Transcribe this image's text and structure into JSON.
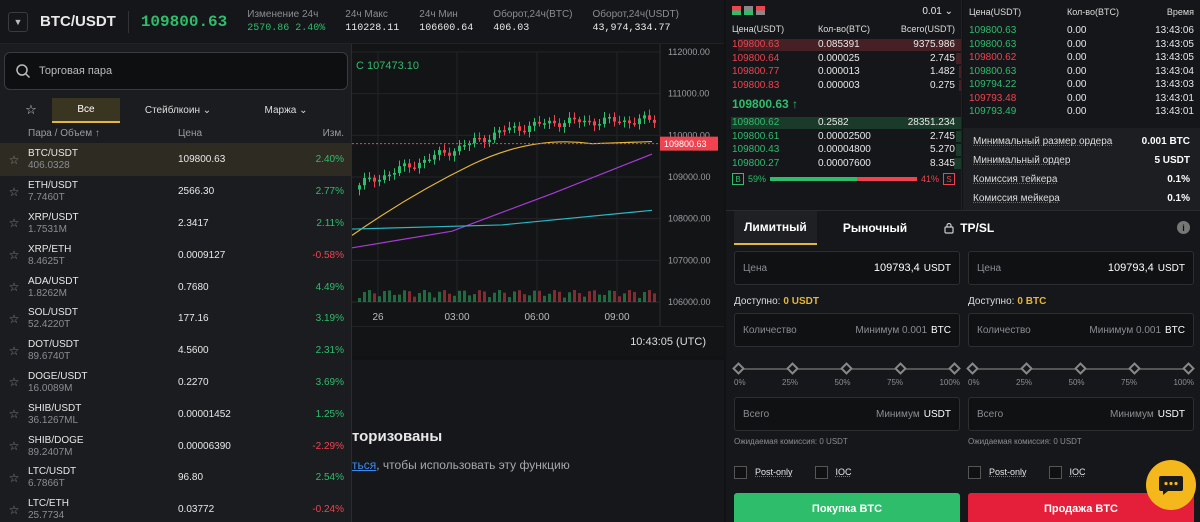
{
  "header": {
    "pair": "BTC/USDT",
    "price": "109800.63",
    "stats": [
      {
        "label": "Изменение 24ч",
        "value": "2570.86 2.40%",
        "color": "green"
      },
      {
        "label": "24ч Макс",
        "value": "110228.11",
        "color": "white"
      },
      {
        "label": "24ч Мин",
        "value": "106600.64",
        "color": "white"
      },
      {
        "label": "Оборот,24ч(BTC)",
        "value": "406.03",
        "color": "white"
      },
      {
        "label": "Оборот,24ч(USDT)",
        "value": "43,974,334.77",
        "color": "white"
      }
    ]
  },
  "market": {
    "search_placeholder": "Торговая пара",
    "tabs": [
      "Все",
      "Стейблкоин ⌄",
      "Маржа ⌄"
    ],
    "col_pair": "Пара / Объем ↑",
    "col_price": "Цена",
    "col_change": "Изм.",
    "rows": [
      {
        "pair": "BTC/USDT",
        "vol": "406.0328",
        "price": "109800.63",
        "change": "2.40%",
        "up": true,
        "selected": true
      },
      {
        "pair": "ETH/USDT",
        "vol": "7.7460T",
        "price": "2566.30",
        "change": "2.77%",
        "up": true
      },
      {
        "pair": "XRP/USDT",
        "vol": "1.7531M",
        "price": "2.3417",
        "change": "2.11%",
        "up": true
      },
      {
        "pair": "XRP/ETH",
        "vol": "8.4625T",
        "price": "0.0009127",
        "change": "-0.58%",
        "up": false
      },
      {
        "pair": "ADA/USDT",
        "vol": "1.8262M",
        "price": "0.7680",
        "change": "4.49%",
        "up": true
      },
      {
        "pair": "SOL/USDT",
        "vol": "52.4220T",
        "price": "177.16",
        "change": "3.19%",
        "up": true
      },
      {
        "pair": "DOT/USDT",
        "vol": "89.6740T",
        "price": "4.5600",
        "change": "2.31%",
        "up": true
      },
      {
        "pair": "DOGE/USDT",
        "vol": "16.0089M",
        "price": "0.2270",
        "change": "3.69%",
        "up": true
      },
      {
        "pair": "SHIB/USDT",
        "vol": "36.1267ML",
        "price": "0.00001452",
        "change": "1.25%",
        "up": true
      },
      {
        "pair": "SHIB/DOGE",
        "vol": "89.2407M",
        "price": "0.00006390",
        "change": "-2.29%",
        "up": false
      },
      {
        "pair": "LTC/USDT",
        "vol": "6.7866T",
        "price": "96.80",
        "change": "2.54%",
        "up": true
      },
      {
        "pair": "LTC/ETH",
        "vol": "25.7734",
        "price": "0.03772",
        "change": "-0.24%",
        "up": false
      }
    ]
  },
  "chart": {
    "close_label": "C 107473.10",
    "price_badge": "109800.63",
    "y_ticks": [
      "112000.00",
      "111000.00",
      "110000.00",
      "109000.00",
      "108000.00",
      "107000.00",
      "106000.00"
    ],
    "x_ticks": [
      "26",
      "03:00",
      "06:00",
      "09:00"
    ],
    "time": "10:43:05 (UTC)",
    "colors": {
      "up": "#2ebd6b",
      "down": "#f0434f",
      "ma1": "#e4b63c",
      "ma2": "#a63bd6",
      "ma3": "#2bb7c4"
    }
  },
  "auth_notice": {
    "title": "торизованы",
    "link": "ться",
    "rest": ", чтобы использовать эту функцию"
  },
  "orderbook": {
    "tick": "0.01 ⌄",
    "headers": [
      "Цена(USDT)",
      "Кол-во(BTC)",
      "Всего(USDT)"
    ],
    "asks": [
      {
        "price": "109800.63",
        "qty": "0.085391",
        "total": "9375.986",
        "depth": 0.95,
        "hl": true
      },
      {
        "price": "109800.64",
        "qty": "0.000025",
        "total": "2.745",
        "depth": 0.02
      },
      {
        "price": "109800.77",
        "qty": "0.000013",
        "total": "1.482",
        "depth": 0.01
      },
      {
        "price": "109800.83",
        "qty": "0.000003",
        "total": "0.275",
        "depth": 0.01
      }
    ],
    "mid_price": "109800.63 ↑",
    "bids": [
      {
        "price": "109800.62",
        "qty": "0.2582",
        "total": "28351.234",
        "depth": 0.98,
        "hl": true
      },
      {
        "price": "109800.61",
        "qty": "0.00002500",
        "total": "2.745",
        "depth": 0.02
      },
      {
        "price": "109800.43",
        "qty": "0.00004800",
        "total": "5.270",
        "depth": 0.02
      },
      {
        "price": "109800.27",
        "qty": "0.00007600",
        "total": "8.345",
        "depth": 0.03
      }
    ],
    "buy_label": "B",
    "buy_pct": "59%",
    "sell_pct": "41%",
    "sell_label": "S",
    "buy_ratio": 0.59
  },
  "trades": {
    "headers": [
      "Цена(USDT)",
      "Кол-во(BTC)",
      "Время"
    ],
    "rows": [
      {
        "price": "109800.63",
        "qty": "0.00",
        "time": "13:43:06",
        "up": true
      },
      {
        "price": "109800.63",
        "qty": "0.00",
        "time": "13:43:05",
        "up": true
      },
      {
        "price": "109800.62",
        "qty": "0.00",
        "time": "13:43:05",
        "up": false
      },
      {
        "price": "109800.63",
        "qty": "0.00",
        "time": "13:43:04",
        "up": true
      },
      {
        "price": "109794.22",
        "qty": "0.00",
        "time": "13:43:03",
        "up": true
      },
      {
        "price": "109793.48",
        "qty": "0.00",
        "time": "13:43:01",
        "up": false
      },
      {
        "price": "109793.49",
        "qty": "0.00",
        "time": "13:43:01",
        "up": true
      }
    ]
  },
  "limits": [
    {
      "label": "Минимальный размер ордера",
      "value": "0.001 BTC"
    },
    {
      "label": "Минимальный ордер",
      "value": "5 USDT"
    },
    {
      "label": "Комиссия тейкера",
      "value": "0.1%"
    },
    {
      "label": "Комиссия мейкера",
      "value": "0.1%"
    }
  ],
  "form": {
    "tabs": [
      "Лимитный",
      "Рыночный",
      "TP/SL"
    ],
    "buy": {
      "price_label": "Цена",
      "price_value": "109793,4",
      "price_unit": "USDT",
      "available_label": "Доступно:",
      "available_value": "0 USDT",
      "qty_label": "Количество",
      "qty_placeholder": "Минимум 0.001",
      "qty_unit": "BTC",
      "total_label": "Всего",
      "total_placeholder": "Минимум",
      "total_unit": "USDT",
      "fee": "Ожидаемая комиссия: 0 USDT",
      "button": "Покупка BTC"
    },
    "sell": {
      "price_label": "Цена",
      "price_value": "109793,4",
      "price_unit": "USDT",
      "available_label": "Доступно:",
      "available_value": "0 BTC",
      "qty_label": "Количество",
      "qty_placeholder": "Минимум 0.001",
      "qty_unit": "BTC",
      "total_label": "Всего",
      "total_placeholder": "Минимум",
      "total_unit": "USDT",
      "fee": "Ожидаемая комиссия: 0 USDT",
      "button": "Продажа BTC"
    },
    "slider_labels": [
      "0%",
      "25%",
      "50%",
      "75%",
      "100%"
    ],
    "post_only": "Post-only",
    "ioc": "IOC"
  }
}
